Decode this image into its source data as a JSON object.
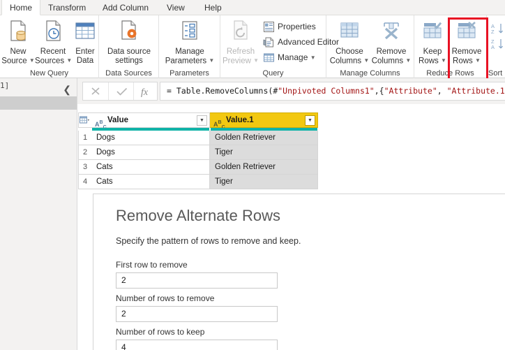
{
  "ribbon": {
    "tabs": [
      {
        "label": "Home",
        "active": true
      },
      {
        "label": "Transform",
        "active": false
      },
      {
        "label": "Add Column",
        "active": false
      },
      {
        "label": "View",
        "active": false
      },
      {
        "label": "Help",
        "active": false
      }
    ],
    "groups": [
      {
        "label": "New Query",
        "buttons": [
          {
            "label_line1": "New",
            "label_line2": "Source",
            "icon": "new-source-icon",
            "caret": true,
            "disabled": false
          },
          {
            "label_line1": "Recent",
            "label_line2": "Sources",
            "icon": "recent-sources-icon",
            "caret": true,
            "disabled": false
          },
          {
            "label_line1": "Enter",
            "label_line2": "Data",
            "icon": "enter-data-icon",
            "caret": false,
            "disabled": false
          }
        ]
      },
      {
        "label": "Data Sources",
        "buttons": [
          {
            "label_line1": "Data source",
            "label_line2": "settings",
            "icon": "data-source-settings-icon",
            "caret": false,
            "disabled": false
          }
        ]
      },
      {
        "label": "Parameters",
        "buttons": [
          {
            "label_line1": "Manage",
            "label_line2": "Parameters",
            "icon": "manage-parameters-icon",
            "caret": true,
            "disabled": false
          }
        ]
      },
      {
        "label": "Query",
        "buttons": [
          {
            "label_line1": "Refresh",
            "label_line2": "Preview",
            "icon": "refresh-preview-icon",
            "caret": true,
            "disabled": true
          }
        ],
        "small_buttons": [
          {
            "label": "Properties",
            "icon": "properties-icon",
            "caret": false
          },
          {
            "label": "Advanced Editor",
            "icon": "advanced-editor-icon",
            "caret": false
          },
          {
            "label": "Manage",
            "icon": "manage-icon",
            "caret": true
          }
        ]
      },
      {
        "label": "Manage Columns",
        "buttons": [
          {
            "label_line1": "Choose",
            "label_line2": "Columns",
            "icon": "choose-columns-icon",
            "caret": true,
            "disabled": false
          },
          {
            "label_line1": "Remove",
            "label_line2": "Columns",
            "icon": "remove-columns-icon",
            "caret": true,
            "disabled": false
          }
        ]
      },
      {
        "label": "Reduce Rows",
        "buttons": [
          {
            "label_line1": "Keep",
            "label_line2": "Rows",
            "icon": "keep-rows-icon",
            "caret": true,
            "disabled": false
          },
          {
            "label_line1": "Remove",
            "label_line2": "Rows",
            "icon": "remove-rows-icon",
            "caret": true,
            "disabled": false,
            "highlighted": true
          }
        ]
      },
      {
        "label": "Sort",
        "small_buttons": [
          {
            "label": "",
            "icon": "sort-ascending-icon",
            "caret": false
          },
          {
            "label": "",
            "icon": "sort-descending-icon",
            "caret": false
          }
        ]
      }
    ],
    "highlight_color": "#e81123"
  },
  "formula_bar": {
    "cancel_icon": "cancel-icon",
    "accept_icon": "checkmark-icon",
    "fx_icon": "fx-icon",
    "prefix": "= Table.RemoveColumns(#",
    "arg1": "\"Unpivoted Columns1\"",
    "mid": ",{",
    "arg2": "\"Attribute\"",
    "sep": ", ",
    "arg3": "\"Attribute.1\"",
    "suffix": "}"
  },
  "queries_pane": {
    "collapse_icon": "chevron-left-icon",
    "clipped_text": "1]"
  },
  "grid": {
    "corner_icon": "select-all-table-icon",
    "columns": [
      {
        "name": "Value",
        "type_icon": "abc-text-type-icon",
        "selected": false,
        "width": 170
      },
      {
        "name": "Value.1",
        "type_icon": "abc-text-type-icon",
        "selected": true,
        "width": 155
      }
    ],
    "rows": [
      {
        "num": "1",
        "cells": [
          "Dogs",
          "Golden Retriever"
        ]
      },
      {
        "num": "2",
        "cells": [
          "Dogs",
          "Tiger"
        ]
      },
      {
        "num": "3",
        "cells": [
          "Cats",
          "Golden Retriever"
        ]
      },
      {
        "num": "4",
        "cells": [
          "Cats",
          "Tiger"
        ]
      }
    ],
    "selected_header_color": "#f2c811",
    "quality_bar_color": "#10b3a8"
  },
  "dialog": {
    "title": "Remove Alternate Rows",
    "subtitle": "Specify the pattern of rows to remove and keep.",
    "fields": [
      {
        "label": "First row to remove",
        "value": "2"
      },
      {
        "label": "Number of rows to remove",
        "value": "2"
      },
      {
        "label": "Number of rows to keep",
        "value": "4"
      }
    ]
  }
}
